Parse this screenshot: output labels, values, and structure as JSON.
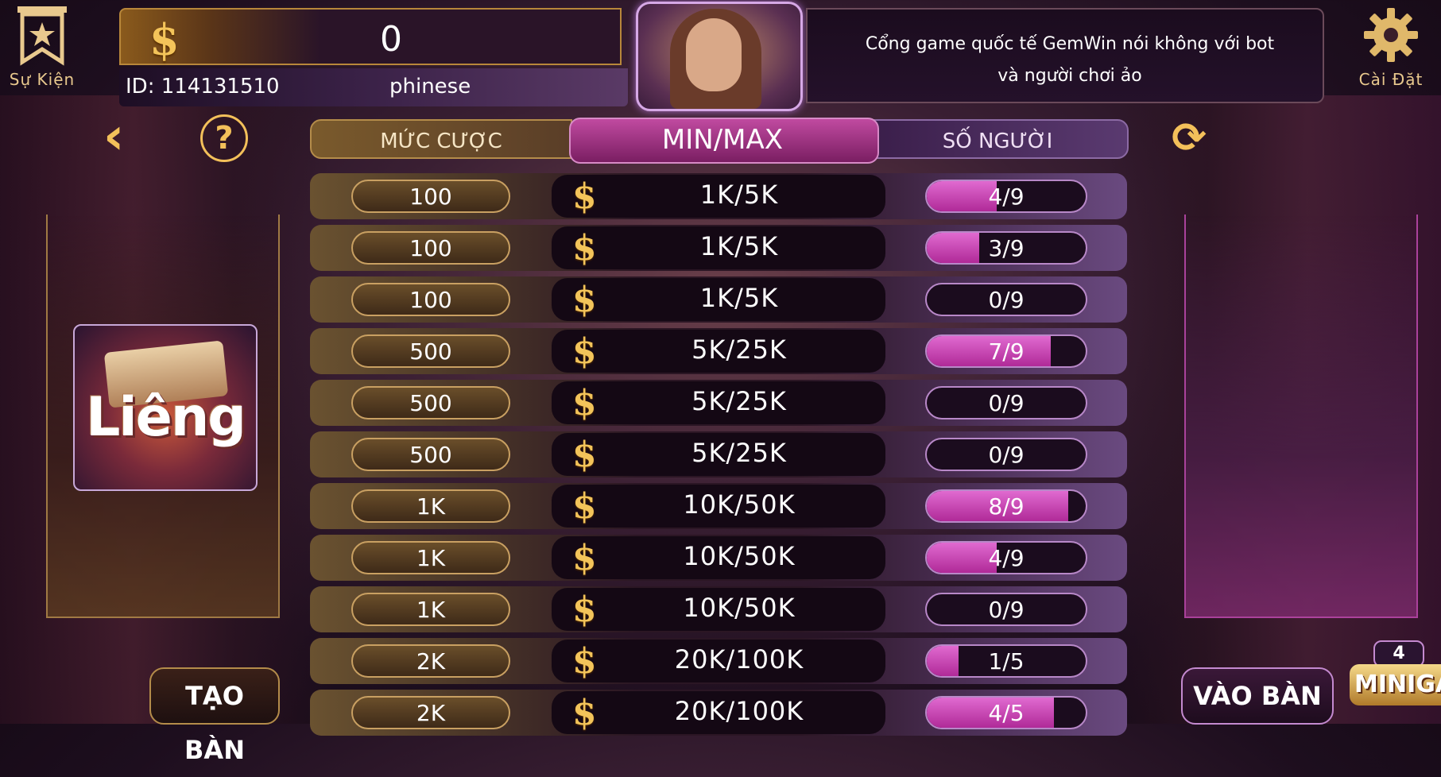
{
  "top_bar": {
    "event_label": "Sự Kiện",
    "settings_label": "Cài Đặt",
    "balance": "0",
    "user_id": "ID: 114131510",
    "username": "phinese",
    "announcement": "Cổng game quốc tế GemWin nói không với bot và người chơi ảo"
  },
  "table_header": {
    "bet": "MỨC CƯỢC",
    "minmax": "MIN/MAX",
    "players": "SỐ NGƯỜI"
  },
  "rows": [
    {
      "bet": "100",
      "range": "1K/5K",
      "players": "4/9",
      "fill": 0.44
    },
    {
      "bet": "100",
      "range": "1K/5K",
      "players": "3/9",
      "fill": 0.33
    },
    {
      "bet": "100",
      "range": "1K/5K",
      "players": "0/9",
      "fill": 0.0
    },
    {
      "bet": "500",
      "range": "5K/25K",
      "players": "7/9",
      "fill": 0.78
    },
    {
      "bet": "500",
      "range": "5K/25K",
      "players": "0/9",
      "fill": 0.0
    },
    {
      "bet": "500",
      "range": "5K/25K",
      "players": "0/9",
      "fill": 0.0
    },
    {
      "bet": "1K",
      "range": "10K/50K",
      "players": "8/9",
      "fill": 0.89
    },
    {
      "bet": "1K",
      "range": "10K/50K",
      "players": "4/9",
      "fill": 0.44
    },
    {
      "bet": "1K",
      "range": "10K/50K",
      "players": "0/9",
      "fill": 0.0
    },
    {
      "bet": "2K",
      "range": "20K/100K",
      "players": "1/5",
      "fill": 0.2
    },
    {
      "bet": "2K",
      "range": "20K/100K",
      "players": "4/5",
      "fill": 0.8
    }
  ],
  "game_logo": "Liêng",
  "buttons": {
    "create_table": "TẠO BÀN",
    "join_table": "VÀO BÀN",
    "minigame": "MINIGAME",
    "minigame_badge": "4"
  },
  "icons": {
    "coin": "$",
    "back": "‹",
    "help": "?",
    "refresh": "⟳"
  },
  "colors": {
    "accent_gold": "#f3c05a",
    "accent_pink": "#c04aa0"
  }
}
